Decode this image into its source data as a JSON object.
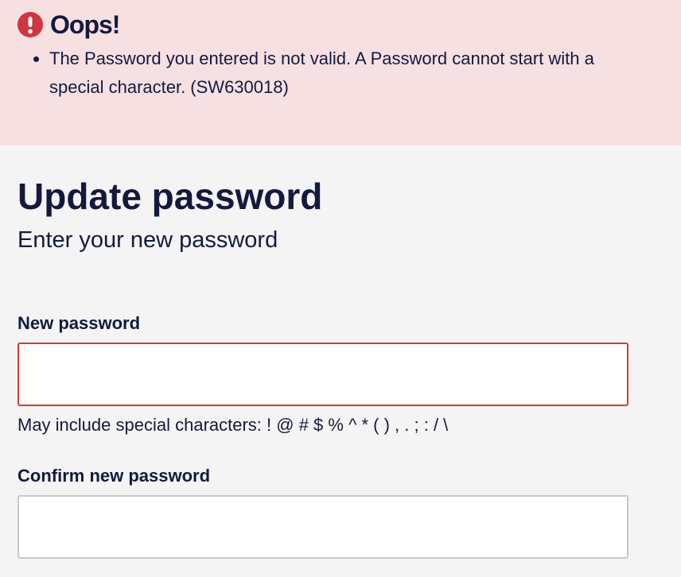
{
  "alert": {
    "title": "Oops!",
    "icon": "error-exclamation-icon",
    "background_color": "#f6e0e2",
    "icon_color": "#d0363f",
    "messages": [
      "The Password you entered is not valid. A Password cannot start with a special character. (SW630018)"
    ]
  },
  "page": {
    "title": "Update password",
    "subtitle": "Enter your new password"
  },
  "form": {
    "new_password": {
      "label": "New password",
      "value": "",
      "placeholder": "",
      "hint": "May include special characters: ! @ # $ % ^ * ( ) , . ; : / \\",
      "state": "error",
      "border_color": "#d13b2f"
    },
    "confirm_password": {
      "label": "Confirm new password",
      "value": "",
      "placeholder": ""
    }
  },
  "colors": {
    "text": "#141a3d",
    "page_background": "#f4f4f4"
  }
}
